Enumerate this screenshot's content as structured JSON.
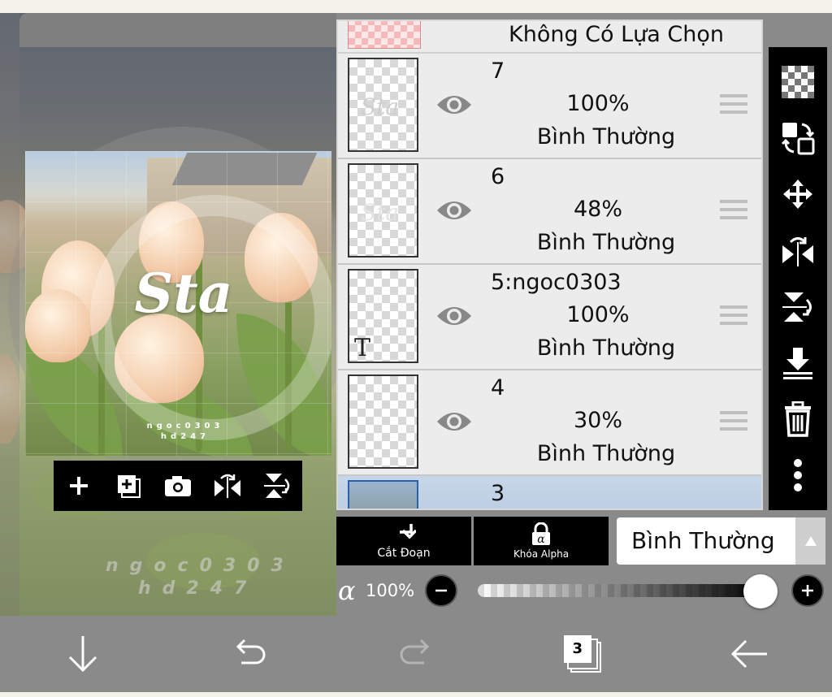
{
  "layers_panel": {
    "header_label": "Không Có Lựa Chọn",
    "layers": [
      {
        "name": "7",
        "opacity": "100%",
        "mode": "Bình Thường"
      },
      {
        "name": "6",
        "opacity": "48%",
        "mode": "Bình Thường"
      },
      {
        "name": "5:ngoc0303",
        "opacity": "100%",
        "mode": "Bình Thường"
      },
      {
        "name": "4",
        "opacity": "30%",
        "mode": "Bình Thường"
      },
      {
        "name": "3"
      }
    ]
  },
  "artwork": {
    "title": "Sta",
    "subtitle_line1": "ngoc0303",
    "subtitle_line2": "hd247"
  },
  "background_watermark": {
    "line1": "ngoc0303",
    "line2": "hd247"
  },
  "controls": {
    "clipping_label": "Cắt Đoạn",
    "alpha_lock_label": "Khóa Alpha",
    "blend_mode": "Bình Thường",
    "alpha_symbol": "α",
    "opacity_value": "100%",
    "opacity_fraction": 1.0
  },
  "bottom_bar": {
    "layer_count": "3"
  },
  "colors": {
    "panel_bg": "#ececec",
    "toolbar_bg": "#000000",
    "app_bg": "#8a8a8a",
    "selected_layer": "#b7c9de"
  }
}
